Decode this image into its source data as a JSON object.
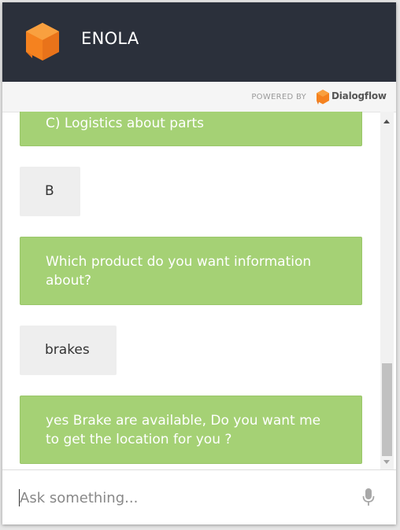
{
  "header": {
    "title": "ENOLA",
    "logo_icon": "agent-cube-icon",
    "accent": "#f5821f"
  },
  "powered_by": {
    "label": "POWERED BY",
    "brand": "Dialogflow"
  },
  "messages": [
    {
      "from": "bot",
      "text": "C) Logistics about parts"
    },
    {
      "from": "user",
      "text": "B"
    },
    {
      "from": "bot",
      "text": "Which product do you want information about?"
    },
    {
      "from": "user",
      "text": "brakes"
    },
    {
      "from": "bot",
      "text": "yes Brake are available, Do you want me to get the location for you ?"
    }
  ],
  "input": {
    "placeholder": "Ask something...",
    "value": ""
  },
  "colors": {
    "header_bg": "#2b303b",
    "bot_bubble": "#a5d175",
    "user_bubble": "#eeeeee"
  }
}
